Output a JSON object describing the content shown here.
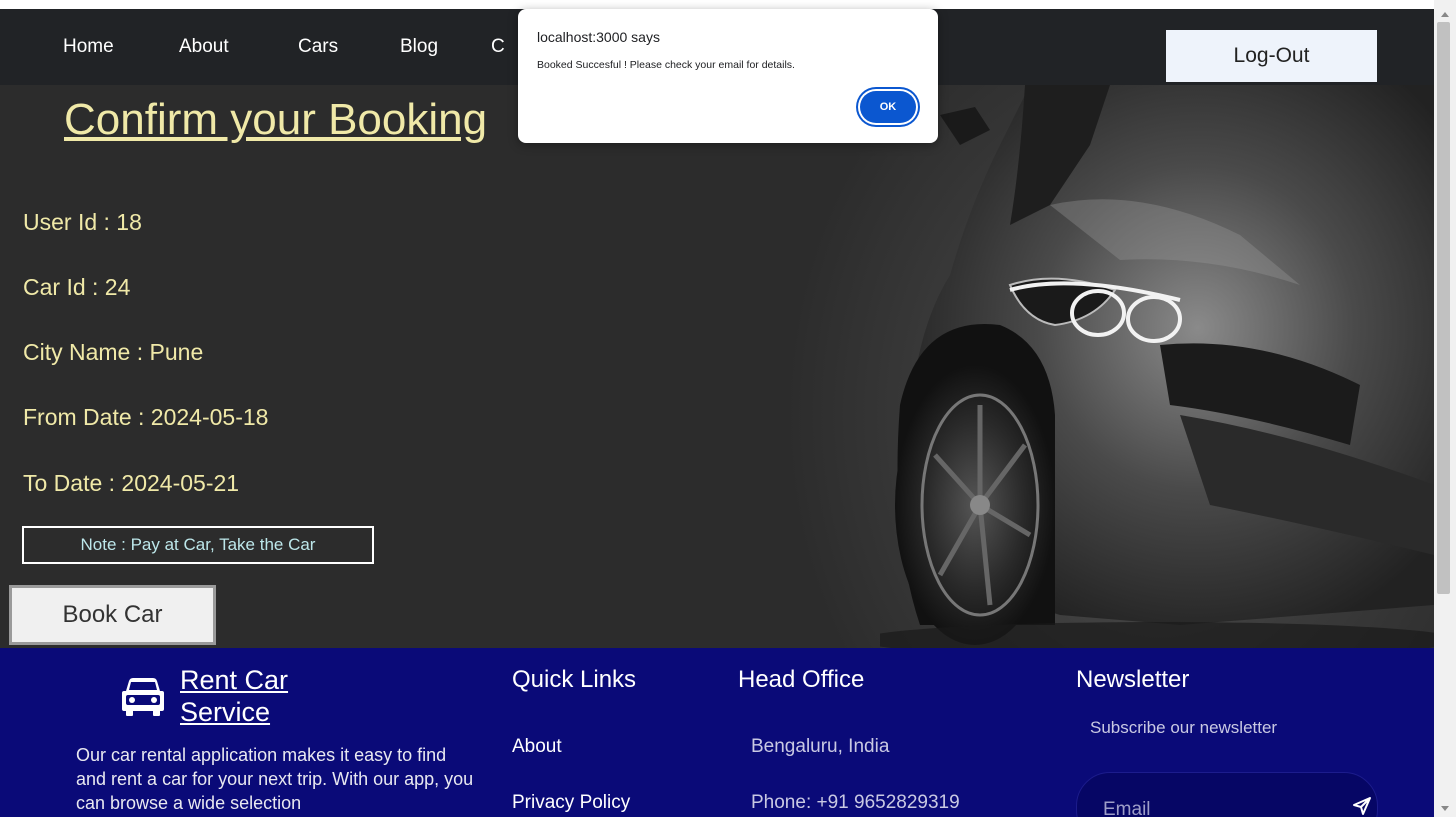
{
  "navbar": {
    "links": [
      "Home",
      "About",
      "Cars",
      "Blog",
      "C"
    ],
    "logout_label": "Log-Out"
  },
  "hero": {
    "title": "Confirm your Booking",
    "user_id": "User Id : 18",
    "car_id": "Car Id : 24",
    "city": "City Name : Pune",
    "from_date": "From Date : 2024-05-18",
    "to_date": "To Date : 2024-05-21",
    "note": "Note : Pay at Car, Take the Car",
    "book_label": "Book Car"
  },
  "footer": {
    "brand_line1": "Rent Car",
    "brand_line2": "Service",
    "description": "Our car rental application makes it easy to find and rent a car for your next trip. With our app, you can browse a wide selection",
    "quick_links_heading": "Quick Links",
    "quick_links": [
      "About",
      "Privacy Policy"
    ],
    "office_heading": "Head Office",
    "office_address": "Bengaluru, India",
    "office_phone": "Phone: +91 9652829319",
    "newsletter_heading": "Newsletter",
    "newsletter_sub": "Subscribe our newsletter",
    "email_placeholder": "Email"
  },
  "dialog": {
    "title": "localhost:3000 says",
    "message": "Booked Succesful ! Please check your email for details.",
    "ok_label": "OK"
  },
  "colors": {
    "navbar_bg": "#212326",
    "accent_text": "#f0e9a8",
    "footer_bg": "#0a0a78",
    "dialog_button": "#0b57d0"
  }
}
